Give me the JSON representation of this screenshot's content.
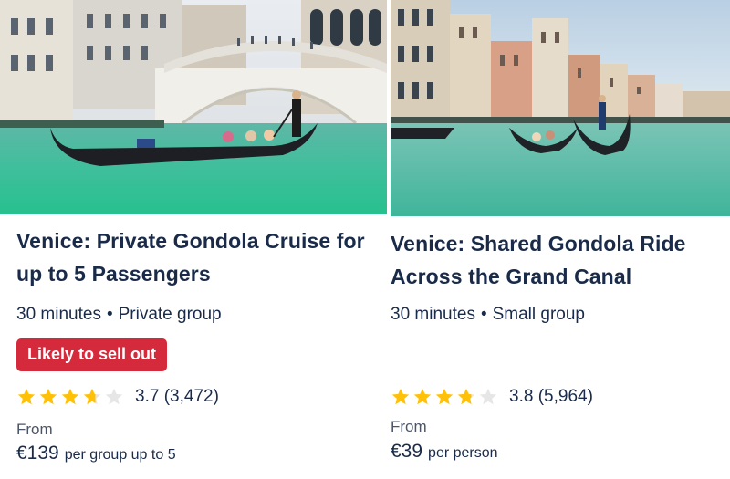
{
  "cards": [
    {
      "image": "venice-rialto-gondola-photo",
      "title": "Venice: Private Gondola Cruise for up to 5 Passengers",
      "duration": "30 minutes",
      "group": "Private group",
      "badge": "Likely to sell out",
      "rating_value": 3.7,
      "rating": "3.7",
      "reviews": "(3,472)",
      "from_label": "From",
      "price": "€139",
      "price_unit": "per group up to 5"
    },
    {
      "image": "venice-grand-canal-gondolas-photo",
      "title": "Venice: Shared Gondola Ride Across the Grand Canal",
      "duration": "30 minutes",
      "group": "Small group",
      "rating_value": 3.8,
      "rating": "3.8",
      "reviews": "(5,964)",
      "from_label": "From",
      "price": "€39",
      "price_unit": "per person"
    }
  ],
  "separator": "•",
  "colors": {
    "text": "#1a2b49",
    "badge": "#d42a3b",
    "star_filled": "#ffc107",
    "star_empty": "#e6e6e6"
  }
}
